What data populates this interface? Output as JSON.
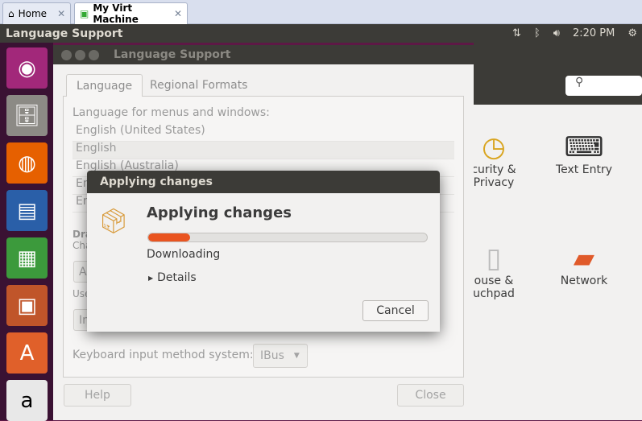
{
  "browser_tabs": [
    {
      "label": "Home",
      "icon": "home-icon"
    },
    {
      "label": "My Virt Machine",
      "icon": "vm-icon",
      "active": true
    }
  ],
  "top_panel": {
    "title": "Language Support",
    "clock": "2:20 PM",
    "icons": [
      "network-icon",
      "bluetooth-icon",
      "volume-icon",
      "gear-icon"
    ]
  },
  "launcher": [
    "ubuntu-dash",
    "files",
    "firefox",
    "libreoffice-writer",
    "libreoffice-calc",
    "libreoffice-impress",
    "software-center",
    "amazon"
  ],
  "settings_window": {
    "items": [
      {
        "label": "Security & Privacy",
        "visible": "curity &\nPrivacy"
      },
      {
        "label": "Text Entry"
      },
      {
        "label": "Mouse & Touchpad",
        "visible": "ouse &\nuchpad"
      },
      {
        "label": "Network"
      }
    ]
  },
  "language_window": {
    "title": "Language Support",
    "tabs": [
      "Language",
      "Regional Formats"
    ],
    "list_label": "Language for menus and windows:",
    "languages": [
      "English (United States)",
      "English",
      "English (Australia)",
      "En",
      "En"
    ],
    "drag_label": "Dra",
    "changes_label": "Cha",
    "apply_button": "A",
    "use_label": "Use",
    "install_button": "In",
    "keyboard_label": "Keyboard input method system:",
    "keyboard_value": "IBus",
    "help": "Help",
    "close": "Close"
  },
  "dialog": {
    "title": "Applying changes",
    "heading": "Applying changes",
    "status": "Downloading",
    "progress_percent": 15,
    "details": "Details",
    "cancel": "Cancel",
    "accent": "#e95420"
  }
}
